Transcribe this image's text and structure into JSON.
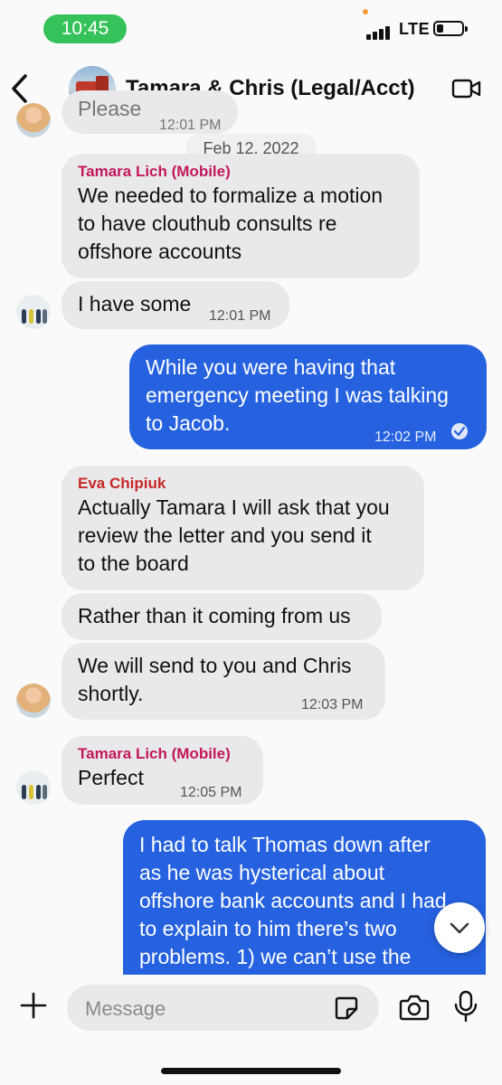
{
  "status_bar": {
    "time": "10:45",
    "network": "LTE"
  },
  "header": {
    "title": "Tamara & Chris (Legal/Acct)"
  },
  "colors": {
    "outgoing_bubble": "#2662e0",
    "incoming_bubble": "#e9e9eb",
    "sender_tamara": "#c2185b",
    "sender_eva": "#c62828",
    "time_pill": "#36c25a"
  },
  "partial_message": {
    "text": "Please",
    "time": "12:01 PM"
  },
  "date_separator": "Feb 12, 2022",
  "messages": [
    {
      "sender": "Tamara Lich (Mobile)",
      "lines": [
        "We needed to formalize a motion",
        "to have clouthub consults re",
        "offshore accounts"
      ]
    },
    {
      "text": "I have some",
      "time": "12:01 PM"
    },
    {
      "lines": [
        "While you were having that",
        "emergency meeting I was talking",
        "to Jacob."
      ],
      "time": "12:02 PM",
      "status_icon": "read-check-icon"
    },
    {
      "sender": "Eva Chipiuk",
      "lines": [
        "Actually Tamara I will ask that you",
        "review the letter and you send it",
        "to the board"
      ]
    },
    {
      "text": "Rather than it coming from us"
    },
    {
      "lines": [
        "We will send to you and Chris",
        "shortly."
      ],
      "time": "12:03 PM"
    },
    {
      "sender": "Tamara Lich (Mobile)",
      "text": "Perfect",
      "time": "12:05 PM"
    },
    {
      "lines": [
        "I had to talk Thomas down after",
        "as he was hysterical about",
        "offshore bank accounts and I had",
        "to explain to him there’s two",
        "problems. 1) we can’t use the"
      ]
    }
  ],
  "composer": {
    "placeholder": "Message"
  },
  "icons": [
    "back-chevron-icon",
    "video-call-icon",
    "plus-icon",
    "sticker-icon",
    "camera-icon",
    "mic-icon",
    "chevron-down-icon",
    "read-check-icon"
  ]
}
